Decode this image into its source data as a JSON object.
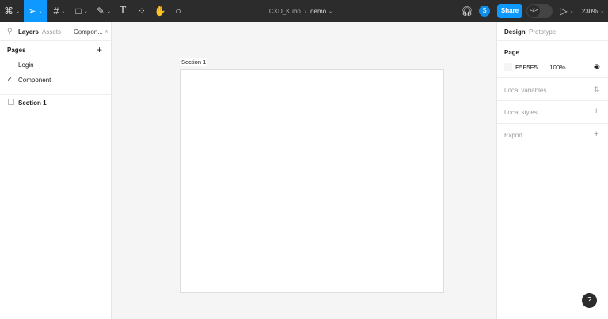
{
  "toolbar": {
    "file_name": "CXD_Kubo",
    "separator": "/",
    "page_name": "demo",
    "share_label": "Share",
    "avatar_initial": "S",
    "zoom": "230%",
    "accent": "#0d99ff"
  },
  "left_panel": {
    "tabs": [
      "Layers",
      "Assets"
    ],
    "page_dropdown": "Compon...",
    "pages_title": "Pages",
    "pages": [
      {
        "label": "Login",
        "selected": false
      },
      {
        "label": "Component",
        "selected": true
      }
    ],
    "layers": [
      "Section 1"
    ]
  },
  "canvas": {
    "section_label": "Section 1"
  },
  "right_panel": {
    "tabs": [
      "Design",
      "Prototype"
    ],
    "page_title": "Page",
    "bg_color": "F5F5F5",
    "opacity": "100%",
    "sections": [
      "Local variables",
      "Local styles",
      "Export"
    ]
  },
  "help": "?"
}
